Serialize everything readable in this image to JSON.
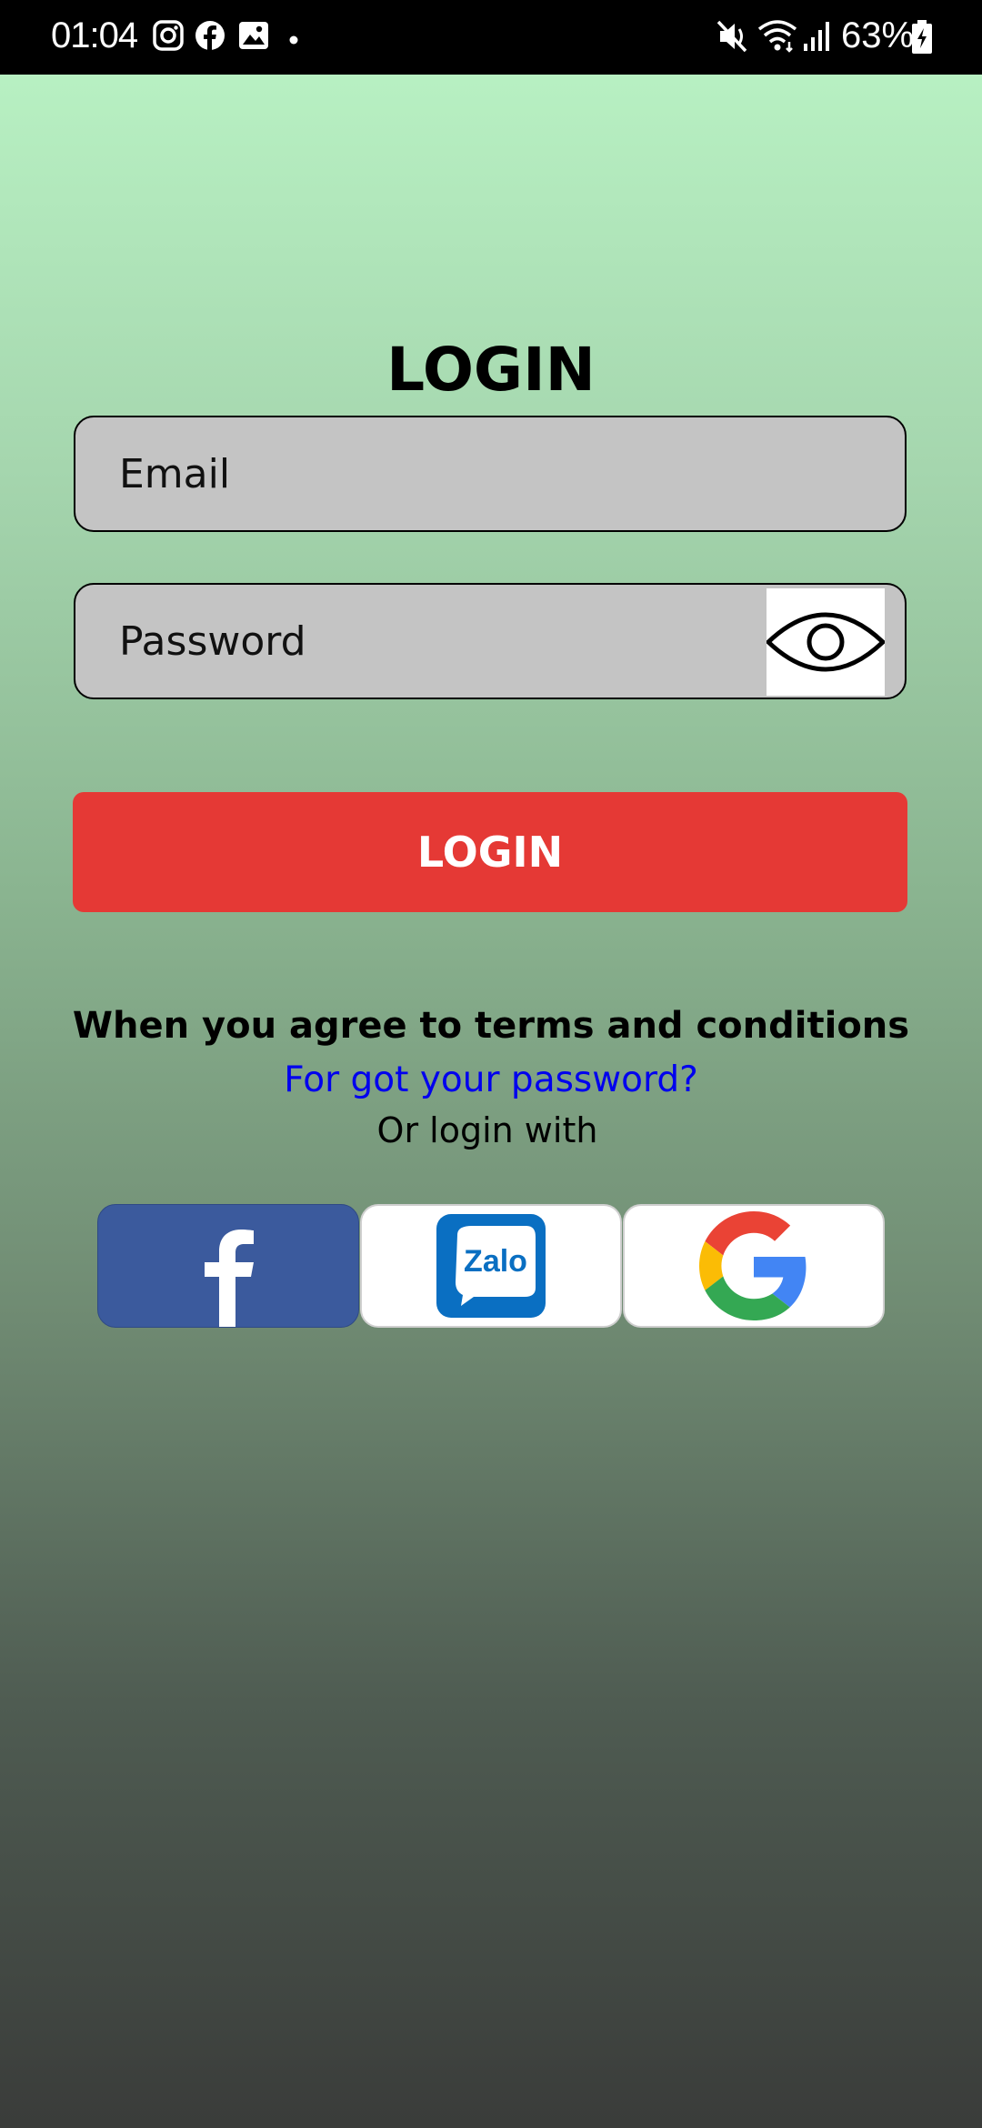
{
  "status_bar": {
    "time": "01:04",
    "notification_icons": [
      "instagram-icon",
      "facebook-icon",
      "gallery-icon",
      "dot-icon"
    ],
    "system_icons": [
      "mute-icon",
      "wifi-icon",
      "signal-icon",
      "battery-icon"
    ],
    "battery": "63%"
  },
  "login": {
    "title": "LOGIN",
    "email_placeholder": "Email",
    "email_value": "",
    "password_placeholder": "Password",
    "password_value": "",
    "show_password_icon": "eye-icon",
    "button_label": "LOGIN",
    "terms_text": "When you agree to terms and conditions",
    "forgot_password": "For got your password?",
    "or_login_with": "Or login with"
  },
  "social": [
    {
      "name": "Facebook",
      "icon": "facebook-logo-icon",
      "background": "#3b5a9d"
    },
    {
      "name": "Zalo",
      "icon": "zalo-logo-icon",
      "logo_text": "Zalo",
      "background": "#ffffff"
    },
    {
      "name": "Google",
      "icon": "google-logo-icon",
      "background": "#ffffff"
    }
  ],
  "colors": {
    "login_button": "#e53935",
    "link": "#0000ee",
    "input_background": "#c4c4c4",
    "gradient_top": "#bbf5c6",
    "gradient_bottom": "#3a3c3a"
  }
}
